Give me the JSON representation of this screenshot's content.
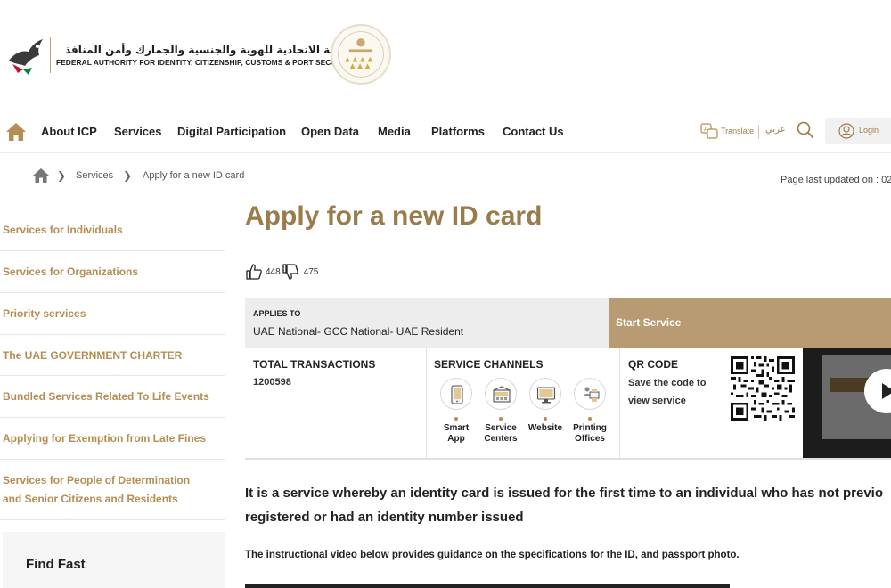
{
  "header": {
    "logo_ar": "الهيئة الاتحادية للهوية والجنسية والجمارك وأمن المنافذ",
    "logo_en": "FEDERAL AUTHORITY FOR IDENTITY, CITIZENSHIP, CUSTOMS & PORT SECURITY"
  },
  "nav": {
    "items": [
      "About ICP",
      "Services",
      "Digital Participation",
      "Open Data",
      "Media",
      "Platforms",
      "Contact Us"
    ],
    "translate_label": "Translate",
    "arabic_label": "عربي",
    "login_label": "Login"
  },
  "breadcrumb": {
    "items": [
      "Services",
      "Apply for a new ID card"
    ],
    "updated_text": "Page last updated on : 02/"
  },
  "sidebar": {
    "items": [
      "Services for Individuals",
      "Services for Organizations",
      "Priority services",
      "The UAE GOVERNMENT CHARTER",
      "Bundled Services Related To Life Events",
      "Applying for Exemption from Late Fines",
      "Services for People of Determination and Senior Citizens and Residents"
    ],
    "find_fast": "Find Fast"
  },
  "main": {
    "title": "Apply for a new ID card",
    "likes": "448",
    "dislikes": "475",
    "applies_to_label": "APPLIES TO",
    "applies_to_value": "UAE National- GCC National- UAE Resident",
    "start_service_label": "Start Service",
    "total_transactions_label": "TOTAL TRANSACTIONS",
    "total_transactions_value": "1200598",
    "service_channels_label": "SERVICE CHANNELS",
    "channels": [
      {
        "line1": "Smart",
        "line2": "App",
        "icon": "smartphone-icon"
      },
      {
        "line1": "Service",
        "line2": "Centers",
        "icon": "building-icon"
      },
      {
        "line1": "Website",
        "line2": "",
        "icon": "monitor-icon"
      },
      {
        "line1": "Printing",
        "line2": "Offices",
        "icon": "printing-office-icon"
      }
    ],
    "qr_label": "QR CODE",
    "qr_text_line1": "Save the code to",
    "qr_text_line2": "view service",
    "description_line1": "It is a service whereby an identity card is issued for the first time to an individual who has not previo",
    "description_line2": "registered or had an identity number issued",
    "instruction": "The instructional video below provides guidance on the specifications for the ID, and passport photo."
  },
  "colors": {
    "brand_gold": "#9a7b4a",
    "sidebar_link": "#b58d52",
    "start_button": "#b89b72",
    "panel_gray": "#ededed"
  }
}
